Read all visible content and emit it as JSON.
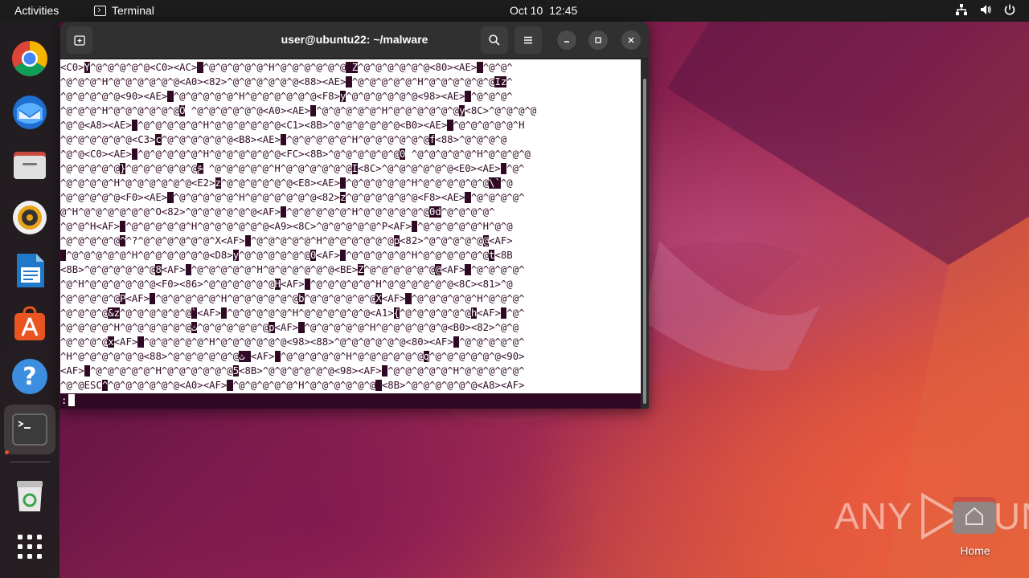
{
  "topbar": {
    "activities": "Activities",
    "app_name": "Terminal",
    "date": "Oct 10",
    "time": "12:45",
    "tray_icons": [
      "network-icon",
      "volume-icon",
      "power-icon"
    ]
  },
  "dock": {
    "items": [
      {
        "name": "chrome",
        "icon": "chrome-icon"
      },
      {
        "name": "thunderbird",
        "icon": "thunderbird-icon"
      },
      {
        "name": "files",
        "icon": "files-icon"
      },
      {
        "name": "rhythmbox",
        "icon": "rhythmbox-icon"
      },
      {
        "name": "libreoffice-writer",
        "icon": "writer-icon"
      },
      {
        "name": "app-center",
        "icon": "app-center-icon"
      },
      {
        "name": "help",
        "icon": "help-icon"
      },
      {
        "name": "terminal",
        "icon": "terminal-icon",
        "active": true
      },
      {
        "name": "trash",
        "icon": "trash-icon"
      },
      {
        "name": "show-apps",
        "icon": "app-grid-icon"
      }
    ],
    "accent": "#e95420"
  },
  "terminal": {
    "title": "user@ubuntu22: ~/malware",
    "prompt": ":",
    "colors": {
      "text": "#300a24",
      "background": "#ffffff",
      "highlight": "#300a24"
    },
    "lines": [
      [
        [
          "<C0>",
          0
        ],
        [
          "Y",
          1
        ],
        [
          "^@^@^@^@^@<C0><AC>",
          0
        ],
        [
          " ",
          1
        ],
        [
          "^@^@^@^@^@^H^@^@^@^@^@^@",
          0
        ],
        [
          " ",
          1
        ],
        [
          "Z",
          1
        ],
        [
          "^@^@^@^@^@^@<80><AE>",
          0
        ],
        [
          " ",
          1
        ],
        [
          "^@^@^",
          0
        ]
      ],
      [
        [
          "^@^@^@^H^@^@^@^@^@^@<A0><82>^@^@^@^@^@^@<88><AE>",
          0
        ],
        [
          " ",
          1
        ],
        [
          "^@^@^@^@^@^H^@^@^@^@^@^@",
          0
        ],
        [
          "Iz",
          1
        ],
        [
          "^",
          0
        ]
      ],
      [
        [
          "^@^@^@^@^@<90><AE>",
          0
        ],
        [
          " ",
          1
        ],
        [
          "^@^@^@^@^@^H^@^@^@^@^@^@<F8>",
          0
        ],
        [
          "y",
          1
        ],
        [
          "^@^@^@^@^@^@<98><AE>",
          0
        ],
        [
          " ",
          1
        ],
        [
          "^@^@^@^",
          0
        ]
      ],
      [
        [
          "^@^@^@^H^@^@^@^@^@^@",
          0
        ],
        [
          "Ô",
          1
        ],
        [
          " ^@^@^@^@^@^@<A0><AE>",
          0
        ],
        [
          " ",
          1
        ],
        [
          "^@^@^@^@^@^H^@^@^@^@^@^@",
          0
        ],
        [
          "y",
          1
        ],
        [
          "<8C>^@^@^@^@",
          0
        ]
      ],
      [
        [
          "^@^@<A8><AE>",
          0
        ],
        [
          " ",
          1
        ],
        [
          "^@^@^@^@^@^H^@^@^@^@^@^@<C1><8B>^@^@^@^@^@^@<B0><AE>",
          0
        ],
        [
          " ",
          1
        ],
        [
          "^@^@^@^@^@^H",
          0
        ]
      ],
      [
        [
          "^@^@^@^@^@^@<C3>",
          0
        ],
        [
          "c",
          1
        ],
        [
          "^@^@^@^@^@^@<B8><AE>",
          0
        ],
        [
          " ",
          1
        ],
        [
          "^@^@^@^@^@^H^@^@^@^@^@^@",
          0
        ],
        [
          "f",
          1
        ],
        [
          "<88>^@^@^@^@",
          0
        ]
      ],
      [
        [
          "^@^@<C0><AE>",
          0
        ],
        [
          " ",
          1
        ],
        [
          "^@^@^@^@^@^H^@^@^@^@^@^@<FC><8B>^@^@^@^@^@^@",
          0
        ],
        [
          "0",
          1
        ],
        [
          " ^@^@^@^@^@^H^@^@^@^@",
          0
        ]
      ],
      [
        [
          "^@^@^@^@^@",
          0
        ],
        [
          "}",
          1
        ],
        [
          "^@^@^@^@^@^@",
          0
        ],
        [
          "ݗ",
          1
        ],
        [
          " ^@^@^@^@^@^H^@^@^@^@^@^@",
          0
        ],
        [
          "I",
          1
        ],
        [
          "<8C>^@^@^@^@^@^@<E0><AE>",
          0
        ],
        [
          " ",
          1
        ],
        [
          "^@^",
          0
        ]
      ],
      [
        [
          "^@^@^@^@^H^@^@^@^@^@^@<E2>",
          0
        ],
        [
          "z",
          1
        ],
        [
          "^@^@^@^@^@^@<E8><AE>",
          0
        ],
        [
          " ",
          1
        ],
        [
          "^@^@^@^@^@^H^@^@^@^@^@^@",
          0
        ],
        [
          "\\`",
          1
        ],
        [
          "^@",
          0
        ]
      ],
      [
        [
          "^@^@^@^@^@<F0><AE>",
          0
        ],
        [
          " ",
          1
        ],
        [
          "^@^@^@^@^@^H^@^@^@^@^@^@<82>",
          0
        ],
        [
          "z",
          1
        ],
        [
          "^@^@^@^@^@^@<F8><AE>",
          0
        ],
        [
          " ",
          1
        ],
        [
          "^@^@^@^@^",
          0
        ]
      ],
      [
        [
          "@^H^@^@^@^@^@^@^O<82>^@^@^@^@^@^@<AF>",
          0
        ],
        [
          " ",
          1
        ],
        [
          "^@^@^@^@^@^H^@^@^@^@^@^@",
          0
        ],
        [
          "0d",
          1
        ],
        [
          "^@^@^@^@^",
          0
        ]
      ],
      [
        [
          "^@^@^H<AF>",
          0
        ],
        [
          " ",
          1
        ],
        [
          "^@^@^@^@^@^H^@^@^@^@^@^@<A9><8C>^@^@^@^@^@^P<AF>",
          0
        ],
        [
          " ",
          1
        ],
        [
          "^@^@^@^@^@^H^@^@",
          0
        ]
      ],
      [
        [
          "^@^@^@^@^@",
          0
        ],
        [
          "^",
          1
        ],
        [
          "^?^@^@^@^@^@^@^X<AF>",
          0
        ],
        [
          " ",
          1
        ],
        [
          "^@^@^@^@^@^H^@^@^@^@^@^@",
          0
        ],
        [
          "p",
          1
        ],
        [
          "<82>^@^@^@^@^@",
          0
        ],
        [
          "@",
          1
        ],
        [
          "<AF>",
          0
        ]
      ],
      [
        [
          " ",
          1
        ],
        [
          "^@^@^@^@^@^H^@^@^@^@^@^@<D8>",
          0
        ],
        [
          "y",
          1
        ],
        [
          "^@^@^@^@^@^@",
          0
        ],
        [
          "0",
          1
        ],
        [
          "<AF>",
          0
        ],
        [
          " ",
          1
        ],
        [
          "^@^@^@^@^@^H^@^@^@^@^@^@",
          0
        ],
        [
          "t",
          1
        ],
        [
          "<8B",
          0
        ]
      ],
      [
        [
          "<8B>^@^@^@^@^@^@",
          0
        ],
        [
          "8",
          1
        ],
        [
          "<AF>",
          0
        ],
        [
          " ",
          1
        ],
        [
          "^@^@^@^@^@^H^@^@^@^@^@^@<BE>",
          0
        ],
        [
          "Z",
          1
        ],
        [
          "^@^@^@^@^@^@",
          0
        ],
        [
          "@",
          1
        ],
        [
          "<AF>",
          0
        ],
        [
          " ",
          1
        ],
        [
          "^@^@^@^@^",
          0
        ]
      ],
      [
        [
          "^@^H^@^@^@^@^@^@<F0><86>^@^@^@^@^@^@",
          0
        ],
        [
          "H",
          1
        ],
        [
          "<AF>",
          0
        ],
        [
          " ",
          1
        ],
        [
          "^@^@^@^@^@^H^@^@^@^@^@^@<8C><81>^@",
          0
        ]
      ],
      [
        [
          "^@^@^@^@^@",
          0
        ],
        [
          "P",
          1
        ],
        [
          "<AF>",
          0
        ],
        [
          " ",
          1
        ],
        [
          "^@^@^@^@^@^H^@^@^@^@^@^@",
          0
        ],
        [
          "b",
          1
        ],
        [
          "^@^@^@^@^@^@",
          0
        ],
        [
          "X",
          1
        ],
        [
          "<AF>",
          0
        ],
        [
          " ",
          1
        ],
        [
          "^@^@^@^@^@^H^@^@^@^",
          0
        ]
      ],
      [
        [
          "^@^@^@^@",
          0
        ],
        [
          "&z",
          1
        ],
        [
          "^@^@^@^@^@^@",
          0
        ],
        [
          "`",
          1
        ],
        [
          "<AF>",
          0
        ],
        [
          " ",
          1
        ],
        [
          "^@^@^@^@^@^H^@^@^@^@^@^@<A1>",
          0
        ],
        [
          "{",
          1
        ],
        [
          "^@^@^@^@^@^@",
          0
        ],
        [
          "h",
          1
        ],
        [
          "<AF>",
          0
        ],
        [
          " ",
          1
        ],
        [
          "^@^",
          0
        ]
      ],
      [
        [
          "^@^@^@^@^H^@^@^@^@^@^@",
          0
        ],
        [
          "ث",
          1
        ],
        [
          "^@^@^@^@^@^@",
          0
        ],
        [
          "p",
          1
        ],
        [
          "<AF>",
          0
        ],
        [
          " ",
          1
        ],
        [
          "^@^@^@^@^@^H^@^@^@^@^@^@<B0><82>^@^@",
          0
        ]
      ],
      [
        [
          "^@^@^@^@",
          0
        ],
        [
          "x",
          1
        ],
        [
          "<AF>",
          0
        ],
        [
          " ",
          1
        ],
        [
          "^@^@^@^@^@^H^@^@^@^@^@^@<98><88>^@^@^@^@^@^@<80><AF>",
          0
        ],
        [
          " ",
          1
        ],
        [
          "^@^@^@^@^@^",
          0
        ]
      ],
      [
        [
          "^H^@^@^@^@^@^@<88>^@^@^@^@^@^@",
          0
        ],
        [
          "ث ",
          1
        ],
        [
          "<AF>",
          0
        ],
        [
          " ",
          1
        ],
        [
          "^@^@^@^@^@^H^@^@^@^@^@^@",
          0
        ],
        [
          "q",
          1
        ],
        [
          "^@^@^@^@^@^@<90>",
          0
        ]
      ],
      [
        [
          "<AF>",
          0
        ],
        [
          " ",
          1
        ],
        [
          "^@^@^@^@^@^H^@^@^@^@^@^@",
          0
        ],
        [
          "5",
          1
        ],
        [
          "<8B>^@^@^@^@^@^@<98><AF>",
          0
        ],
        [
          " ",
          1
        ],
        [
          "^@^@^@^@^@^H^@^@^@^@^@^",
          0
        ]
      ],
      [
        [
          "^@^@ESC",
          0
        ],
        [
          "^",
          1
        ],
        [
          "^@^@^@^@^@^@<A0><AF>",
          0
        ],
        [
          " ",
          1
        ],
        [
          "^@^@^@^@^@^H^@^@^@^@^@^@",
          0
        ],
        [
          " ",
          1
        ],
        [
          "<8B>^@^@^@^@^@^@<A8><AF>",
          0
        ]
      ]
    ]
  },
  "desktop": {
    "home_label": "Home",
    "watermark_left": "ANY",
    "watermark_right": "RUN"
  }
}
